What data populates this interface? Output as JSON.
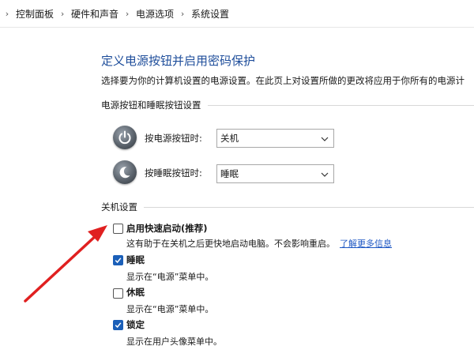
{
  "breadcrumb": {
    "items": [
      "控制面板",
      "硬件和声音",
      "电源选项",
      "系统设置"
    ]
  },
  "page": {
    "title": "定义电源按钮并启用密码保护",
    "description": "选择要为你的计算机设置的电源设置。在此页上对设置所做的更改将应用于你所有的电源计"
  },
  "power_section": {
    "header": "电源按钮和睡眠按钮设置",
    "power_button": {
      "label": "按电源按钮时:",
      "value": "关机",
      "icon": "power-icon"
    },
    "sleep_button": {
      "label": "按睡眠按钮时:",
      "value": "睡眠",
      "icon": "sleep-icon"
    }
  },
  "shutdown_section": {
    "header": "关机设置",
    "options": [
      {
        "label": "启用快速启动(推荐)",
        "desc": "这有助于在关机之后更快地启动电脑。不会影响重启。",
        "link": "了解更多信息",
        "checked": false
      },
      {
        "label": "睡眠",
        "desc": "显示在“电源”菜单中。",
        "checked": true
      },
      {
        "label": "休眠",
        "desc": "显示在“电源”菜单中。",
        "checked": false
      },
      {
        "label": "锁定",
        "desc": "显示在用户头像菜单中。",
        "checked": true
      }
    ]
  },
  "colors": {
    "title": "#1f4e9b",
    "link": "#1f58c4",
    "checkbox_checked": "#1b5fb8",
    "annotation_arrow": "#e02020"
  }
}
